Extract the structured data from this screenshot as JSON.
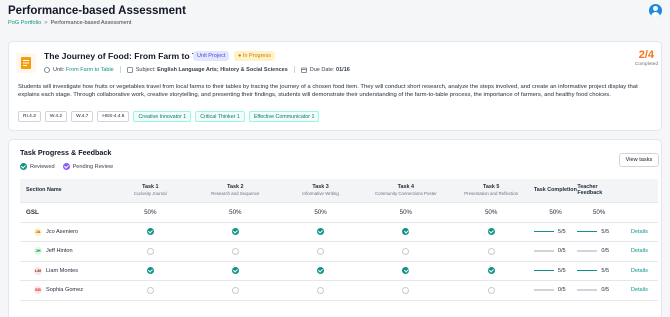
{
  "header": {
    "title": "Performance-based Assessment",
    "breadcrumb": {
      "parent": "PoG Portfolio",
      "separator": ">",
      "current": "Performance-based Assessment"
    }
  },
  "project": {
    "title": "The Journey of Food: From Farm to Table",
    "type_badge": "Unit Project",
    "status_badge": "In Progress",
    "unit_label": "Unit:",
    "unit_value": "From Farm to Table",
    "subject_label": "Subject:",
    "subject_value": "English Language Arts; History & Social Sciences",
    "due_label": "Due Date:",
    "due_value": "01/16",
    "completed_count": "2/4",
    "completed_label": "Completed",
    "description": "Students will investigate how fruits or vegetables travel from local farms to their tables by tracing the journey of a chosen food item. They will conduct short research, analyze the steps involved, and create an informative project display that explains each stage. Through collaborative work, creative storytelling, and presenting their findings, students will demonstrate their understanding of the farm-to-table process, the importance of farmers, and healthy food choices.",
    "standards": [
      "RI.4.3",
      "W.4.2",
      "W.4.7",
      "HSS-4.4.6"
    ],
    "competencies": [
      "Creative Innovator 1",
      "Critical Thinker 1",
      "Effective Communicator 1"
    ]
  },
  "progress": {
    "title": "Task Progress & Feedback",
    "view_button": "View tasks",
    "legend": {
      "reviewed": "Reviewed",
      "pending": "Pending Review"
    },
    "columns": {
      "section": "Section Name",
      "tasks": [
        {
          "name": "Task 1",
          "sub": "Curiosity Journal"
        },
        {
          "name": "Task 2",
          "sub": "Research and Sequence"
        },
        {
          "name": "Task 3",
          "sub": "Informative Writing"
        },
        {
          "name": "Task 4",
          "sub": "Community Connections Poster"
        },
        {
          "name": "Task 5",
          "sub": "Presentation and Reflection"
        }
      ],
      "completion": "Task Completion",
      "feedback": "Teacher Feedback"
    },
    "gsl": {
      "name": "GSL",
      "tasks": [
        "50%",
        "50%",
        "50%",
        "50%",
        "50%"
      ],
      "completion": "50%",
      "feedback": "50%"
    },
    "students": [
      {
        "initials": "JA",
        "name": "Jco Aseniero",
        "avatar_bg": "#fef3c7",
        "avatar_fg": "#b45309",
        "done": [
          true,
          true,
          true,
          true,
          true
        ],
        "completion": "5/5",
        "completion_fraction": 1.0,
        "feedback": "5/5",
        "feedback_fraction": 1.0,
        "action": "Details"
      },
      {
        "initials": "JH",
        "name": "Jeff Hinton",
        "avatar_bg": "#dcfce7",
        "avatar_fg": "#15803d",
        "done": [
          false,
          false,
          false,
          false,
          false
        ],
        "completion": "0/5",
        "completion_fraction": 0,
        "feedback": "0/5",
        "feedback_fraction": 0,
        "action": "Details"
      },
      {
        "initials": "LM",
        "name": "Liam Montes",
        "avatar_bg": "#fde2e2",
        "avatar_fg": "#7f1d1d",
        "done": [
          true,
          true,
          true,
          true,
          true
        ],
        "completion": "5/5",
        "completion_fraction": 1.0,
        "feedback": "5/5",
        "feedback_fraction": 1.0,
        "action": "Details"
      },
      {
        "initials": "SG",
        "name": "Sophia Gomez",
        "avatar_bg": "#fee2e2",
        "avatar_fg": "#b91c1c",
        "done": [
          false,
          false,
          false,
          false,
          false
        ],
        "completion": "0/5",
        "completion_fraction": 0,
        "feedback": "0/5",
        "feedback_fraction": 0,
        "action": "Details"
      }
    ]
  },
  "colors": {
    "accent": "#0d9488",
    "status_orange": "#f97316",
    "pending_purple": "#8b5cf6"
  }
}
